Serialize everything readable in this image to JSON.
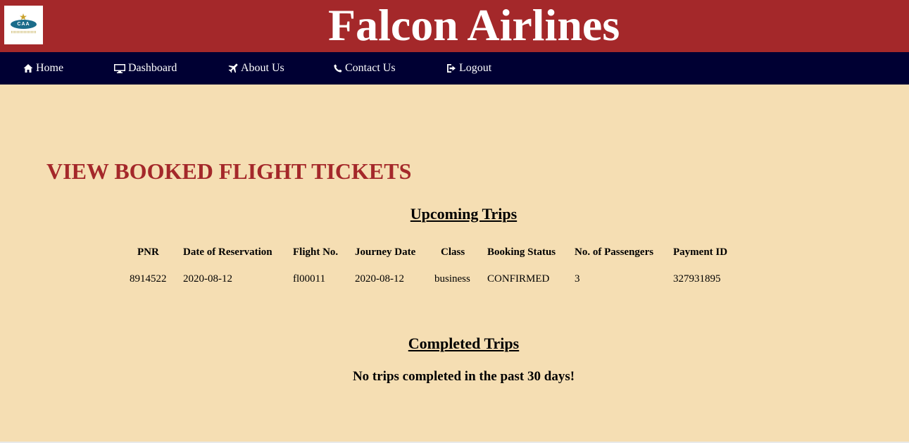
{
  "header": {
    "brand": "Falcon Airlines",
    "logo_text": "CAA",
    "brand_color": "#a4282a",
    "nav_color": "#000033",
    "background": "#f5deb3"
  },
  "nav": {
    "items": [
      {
        "label": "Home",
        "icon": "home-icon"
      },
      {
        "label": "Dashboard",
        "icon": "monitor-icon"
      },
      {
        "label": "About Us",
        "icon": "plane-icon"
      },
      {
        "label": "Contact Us",
        "icon": "phone-icon"
      },
      {
        "label": "Logout",
        "icon": "logout-icon"
      }
    ]
  },
  "main": {
    "page_title": "VIEW BOOKED FLIGHT TICKETS",
    "upcoming": {
      "title": "Upcoming Trips",
      "columns": [
        "PNR",
        "Date of Reservation",
        "Flight No.",
        "Journey Date",
        "Class",
        "Booking Status",
        "No. of Passengers",
        "Payment ID"
      ],
      "rows": [
        [
          "8914522",
          "2020-08-12",
          "fl00011",
          "2020-08-12",
          "business",
          "CONFIRMED",
          "3",
          "327931895"
        ]
      ]
    },
    "completed": {
      "title": "Completed Trips",
      "message": "No trips completed in the past 30 days!"
    }
  }
}
